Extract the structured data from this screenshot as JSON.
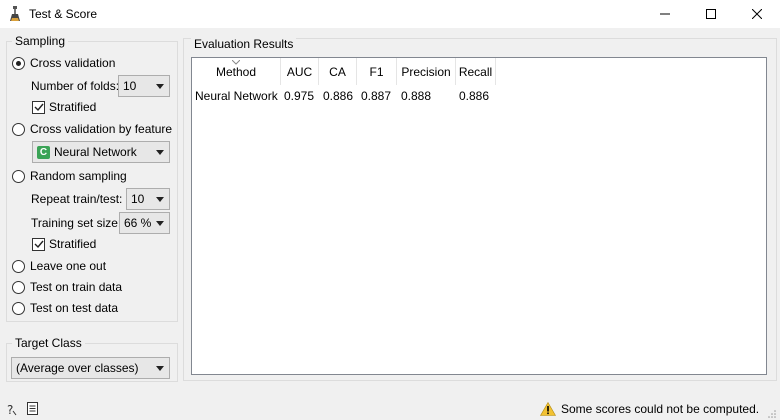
{
  "window": {
    "title": "Test & Score",
    "minimize_icon": "minimize-icon",
    "maximize_icon": "maximize-icon",
    "close_icon": "close-icon"
  },
  "sampling": {
    "title": "Sampling",
    "options": {
      "cross_validation": "Cross validation",
      "cv_by_feature": "Cross validation by feature",
      "random_sampling": "Random sampling",
      "leave_one_out": "Leave one out",
      "test_on_train": "Test on train data",
      "test_on_test": "Test on test data"
    },
    "selected": "Cross validation",
    "folds_label": "Number of folds:",
    "folds_value": "10",
    "stratified_label": "Stratified",
    "feature_value": "Neural Network",
    "feature_badge": "C",
    "repeat_label": "Repeat train/test:",
    "repeat_value": "10",
    "train_size_label": "Training set size:",
    "train_size_value": "66 %",
    "stratified2_label": "Stratified"
  },
  "target": {
    "title": "Target Class",
    "value": "(Average over classes)"
  },
  "results": {
    "title": "Evaluation Results",
    "headers": [
      "Method",
      "AUC",
      "CA",
      "F1",
      "Precision",
      "Recall"
    ],
    "rows": [
      [
        "Neural Network",
        "0.975",
        "0.886",
        "0.887",
        "0.888",
        "0.886"
      ]
    ]
  },
  "status": {
    "message": "Some scores could not be computed.",
    "warning_icon": "warning-icon",
    "help_icon": "help-icon",
    "report_icon": "report-icon"
  },
  "colors": {
    "badge_green": "#3aa356",
    "warning_yellow": "#f2c233"
  }
}
